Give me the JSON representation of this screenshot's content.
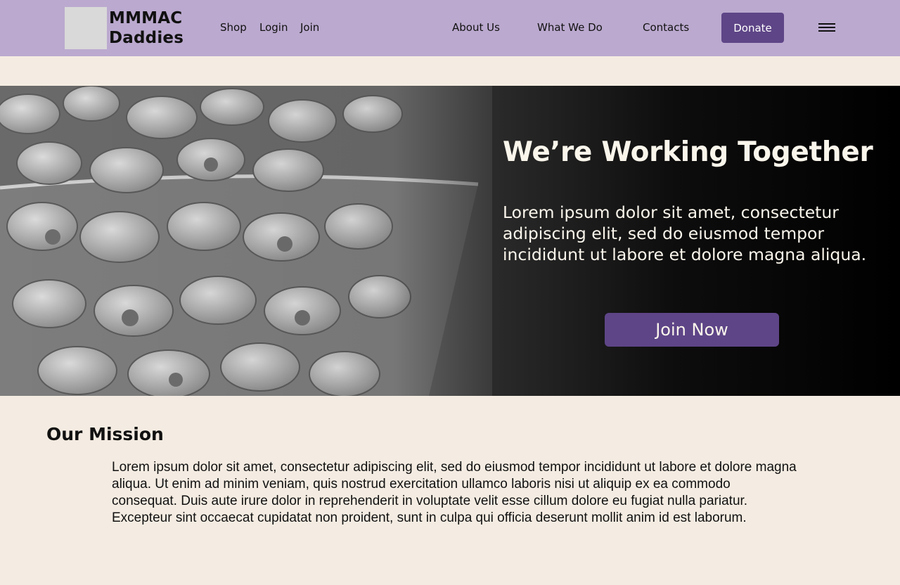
{
  "header": {
    "brand_line1": "MMMAC",
    "brand_line2": "Daddies",
    "nav_left": [
      "Shop",
      "Login",
      "Join"
    ],
    "nav_right": [
      "About Us",
      "What We Do",
      "Contacts"
    ],
    "donate_label": "Donate",
    "menu_icon": "hamburger-menu-icon"
  },
  "hero": {
    "title": "We’re Working Together",
    "text": "Lorem ipsum dolor sit amet, consectetur adipiscing elit, sed do eiusmod tempor incididunt ut labore et dolore magna aliqua.",
    "button_label": "Join Now",
    "image": "macaroni-bowl-photo"
  },
  "mission": {
    "title": "Our Mission",
    "text": "Lorem ipsum dolor sit amet, consectetur adipiscing elit, sed do eiusmod tempor incididunt ut labore et dolore magna aliqua. Ut enim ad minim veniam, quis nostrud exercitation ullamco laboris nisi ut aliquip ex ea commodo consequat. Duis aute irure dolor in reprehenderit in voluptate velit esse cillum dolore eu fugiat nulla pariatur. Excepteur sint occaecat cupidatat non proident, sunt in culpa qui officia deserunt mollit anim id est laborum."
  },
  "colors": {
    "header_bg": "#bba9cf",
    "accent": "#5e4587",
    "page_bg": "#f4ece2",
    "hero_text": "#fbf6ec"
  }
}
